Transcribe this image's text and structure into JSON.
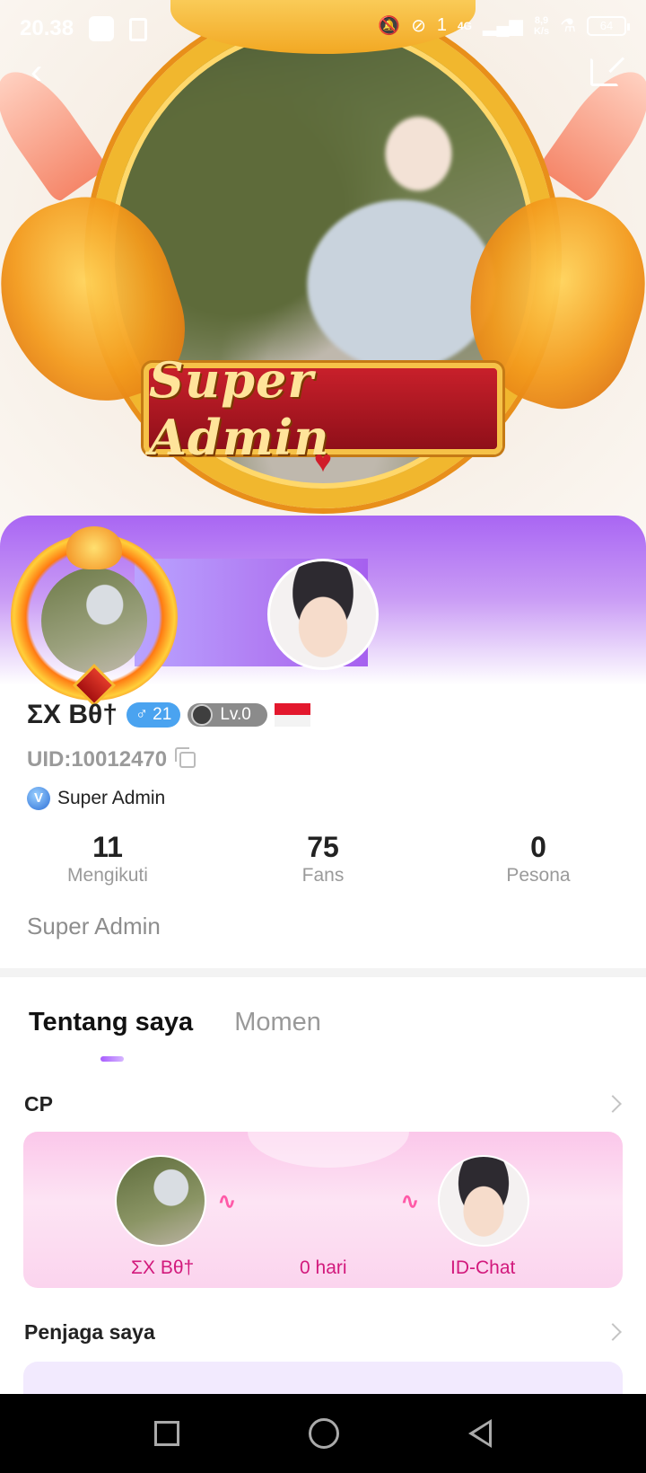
{
  "status_bar": {
    "time": "20.38",
    "signal_text": "1",
    "network": "4G",
    "speed_top": "8,9",
    "speed_bottom": "K/s",
    "battery": "64"
  },
  "hero": {
    "banner_text": "Super Admin"
  },
  "profile": {
    "name": "ΣX Bθ†",
    "gender_symbol": "♂",
    "age": "21",
    "level": "Lv.0",
    "uid": "UID:10012470",
    "role": "Super Admin",
    "bio": "Super Admin",
    "stats": [
      {
        "value": "11",
        "label": "Mengikuti"
      },
      {
        "value": "75",
        "label": "Fans"
      },
      {
        "value": "0",
        "label": "Pesona"
      }
    ]
  },
  "tabs": [
    {
      "label": "Tentang saya",
      "active": true
    },
    {
      "label": "Momen",
      "active": false
    }
  ],
  "cp": {
    "title": "CP",
    "left_name": "ΣX Bθ†",
    "days": "0 hari",
    "right_name": "ID-Chat"
  },
  "guardian": {
    "title": "Penjaga saya"
  },
  "icons": {
    "back": "chevron-left-icon",
    "edit": "edit-icon",
    "copy": "copy-icon",
    "verified": "v-badge-icon"
  },
  "colors": {
    "accent_purple": "#a966f3",
    "gender_badge": "#4aa3f0",
    "cp_text": "#d2197c"
  }
}
